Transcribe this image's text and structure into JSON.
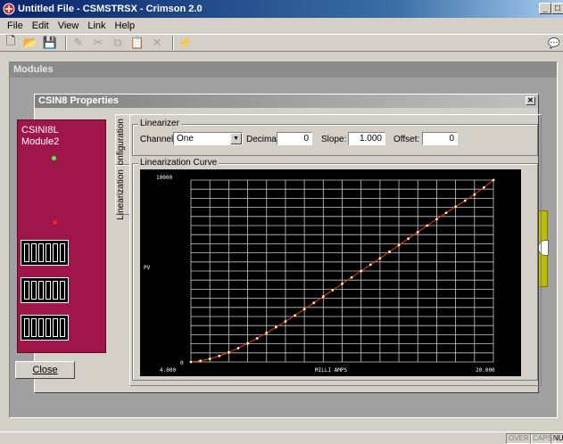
{
  "window": {
    "title": "Untitled File - CSMSTRSX - Crimson 2.0"
  },
  "menu": {
    "items": [
      "File",
      "Edit",
      "View",
      "Link",
      "Help"
    ]
  },
  "toolbar": {
    "buttons": [
      {
        "icon": "new-file-icon",
        "glyph": "🗋"
      },
      {
        "icon": "open-folder-icon",
        "glyph": "📂"
      },
      {
        "icon": "save-icon",
        "glyph": "💾"
      },
      {
        "icon": "pen-icon",
        "glyph": "✎"
      },
      {
        "icon": "cut-icon",
        "glyph": "✂"
      },
      {
        "icon": "copy-icon",
        "glyph": "⧉"
      },
      {
        "icon": "paste-icon",
        "glyph": "📋"
      },
      {
        "icon": "delete-icon",
        "glyph": "✕"
      },
      {
        "icon": "lightning-icon",
        "glyph": "⚡"
      }
    ]
  },
  "modules": {
    "header": "Modules"
  },
  "dialog": {
    "title": "CSIN8 Properties",
    "module_name_line1": "CSINI8L",
    "module_name_line2": "Module2",
    "close_label": "Close",
    "tabs": {
      "configuration": "Configuration",
      "linearization": "Linearization"
    },
    "linearizer": {
      "group_label": "Linearizer",
      "channel_label": "Channel:",
      "channel_value": "One",
      "decimals_label": "Decimals:",
      "decimals_value": "0",
      "slope_label": "Slope:",
      "slope_value": "1.000",
      "offset_label": "Offset:",
      "offset_value": "0"
    },
    "curve_group_label": "Linearization Curve"
  },
  "chart_data": {
    "type": "line",
    "xlabel": "MILLI AMPS",
    "ylabel": "PV",
    "x_tick_labels": [
      "4.000",
      "20.000"
    ],
    "y_tick_labels": [
      "0",
      "10000"
    ],
    "xlim": [
      4.0,
      20.0
    ],
    "ylim": [
      0,
      10000
    ],
    "grid": true,
    "series": [
      {
        "color": "#ff3030",
        "x": [
          4.0,
          4.5,
          5.0,
          5.5,
          6.0,
          6.5,
          7.0,
          7.5,
          8.0,
          8.5,
          9.0,
          9.5,
          10.0,
          10.5,
          11.0,
          11.5,
          12.0,
          12.5,
          13.0,
          13.5,
          14.0,
          14.5,
          15.0,
          15.5,
          16.0,
          16.5,
          17.0,
          17.5,
          18.0,
          18.5,
          19.0,
          19.5,
          20.0
        ],
        "y": [
          0,
          60,
          170,
          330,
          530,
          760,
          1020,
          1300,
          1600,
          1910,
          2230,
          2560,
          2900,
          3250,
          3600,
          3950,
          4300,
          4650,
          5000,
          5350,
          5700,
          6060,
          6420,
          6780,
          7140,
          7500,
          7850,
          8200,
          8540,
          8870,
          9210,
          9600,
          10000
        ]
      }
    ]
  },
  "status": {
    "over": "OVER",
    "caps": "CAPS",
    "num": "NU"
  }
}
